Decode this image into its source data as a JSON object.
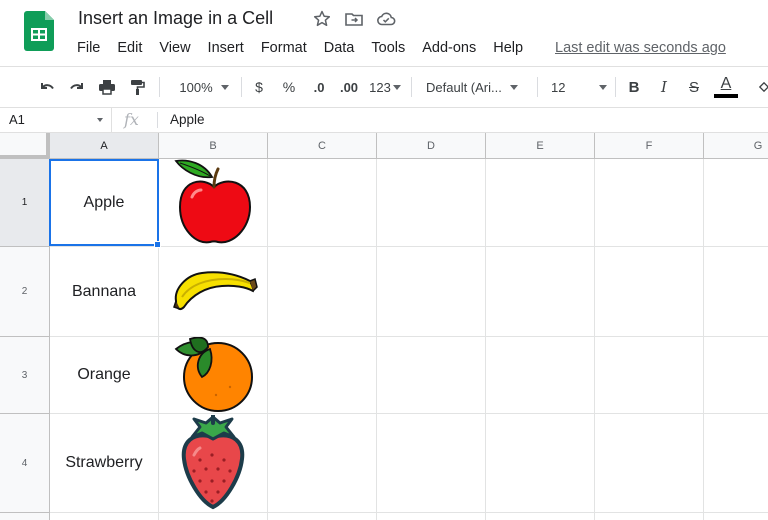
{
  "doc": {
    "title": "Insert an Image in a Cell",
    "last_edit": "Last edit was seconds ago"
  },
  "menu": [
    "File",
    "Edit",
    "View",
    "Insert",
    "Format",
    "Data",
    "Tools",
    "Add-ons",
    "Help"
  ],
  "toolbar": {
    "zoom": "100%",
    "currency": "$",
    "percent": "%",
    "decrease_decimal": ".0",
    "increase_decimal": ".00",
    "more_formats": "123",
    "font": "Default (Ari...",
    "font_size": "12",
    "bold": "B",
    "italic": "I",
    "strikethrough": "S",
    "text_color_letter": "A",
    "text_color": "#000000"
  },
  "formula_bar": {
    "name_box": "A1",
    "fx": "fx",
    "value": "Apple"
  },
  "columns": [
    "A",
    "B",
    "C",
    "D",
    "E",
    "F",
    "G"
  ],
  "rows": [
    {
      "num": "1",
      "name": "Apple",
      "image": "apple"
    },
    {
      "num": "2",
      "name": "Bannana",
      "image": "banana"
    },
    {
      "num": "3",
      "name": "Orange",
      "image": "orange"
    },
    {
      "num": "4",
      "name": "Strawberry",
      "image": "strawberry"
    }
  ],
  "selected_cell": "A1",
  "colors": {
    "selection": "#1a73e8",
    "sheets_green": "#0f9d58"
  }
}
